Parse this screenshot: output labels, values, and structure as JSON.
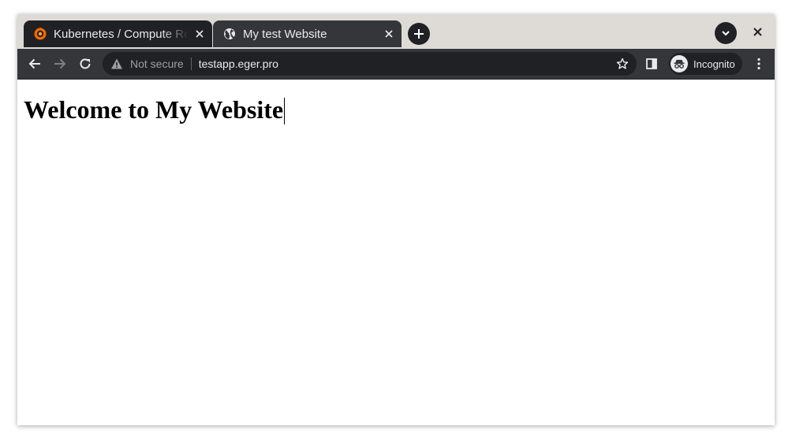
{
  "tabs": [
    {
      "title": "Kubernetes / Compute Resources",
      "favicon": "grafana-icon",
      "active": false
    },
    {
      "title": "My test Website",
      "favicon": "globe-icon",
      "active": true
    }
  ],
  "toolbar": {
    "security_label": "Not secure",
    "url": "testapp.eger.pro",
    "profile_label": "Incognito"
  },
  "page": {
    "heading": "Welcome to My Website"
  },
  "colors": {
    "frame": "#dedbd7",
    "toolbar": "#35363a",
    "inactive_tab": "#202124",
    "omnibox": "#202124",
    "grafana_orange": "#f46800"
  }
}
